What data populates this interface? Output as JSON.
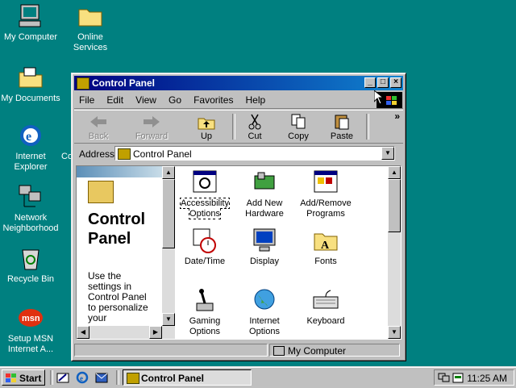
{
  "desktop": {
    "icons": [
      {
        "label": "My Computer"
      },
      {
        "label": "Online Services"
      },
      {
        "label": "My Documents"
      },
      {
        "label": "Internet Explorer"
      },
      {
        "label": "Network Neighborhood"
      },
      {
        "label": "Recycle Bin"
      },
      {
        "label": "Setup MSN Internet A..."
      }
    ],
    "partial_label": "Co"
  },
  "window": {
    "title": "Control Panel",
    "menu": [
      "File",
      "Edit",
      "View",
      "Go",
      "Favorites",
      "Help"
    ],
    "toolbar": {
      "back": "Back",
      "forward": "Forward",
      "up": "Up",
      "cut": "Cut",
      "copy": "Copy",
      "paste": "Paste",
      "more": "»"
    },
    "address": {
      "label": "Address",
      "value": "Control Panel"
    },
    "left_pane": {
      "title": "Control Panel",
      "description": "Use the settings in Control Panel to personalize your"
    },
    "items": [
      {
        "label": "Accessibility Options",
        "icon": "accessibility-icon"
      },
      {
        "label": "Add New Hardware",
        "icon": "hardware-icon"
      },
      {
        "label": "Add/Remove Programs",
        "icon": "programs-icon"
      },
      {
        "label": "Date/Time",
        "icon": "clock-icon"
      },
      {
        "label": "Display",
        "icon": "display-icon"
      },
      {
        "label": "Fonts",
        "icon": "fonts-icon"
      },
      {
        "label": "Gaming Options",
        "icon": "joystick-icon"
      },
      {
        "label": "Internet Options",
        "icon": "globe-icon"
      },
      {
        "label": "Keyboard",
        "icon": "keyboard-icon"
      }
    ],
    "status": {
      "location": "My Computer"
    }
  },
  "taskbar": {
    "start": "Start",
    "task": "Control Panel",
    "clock": "11:25 AM"
  },
  "colors": {
    "desktop": "#008080",
    "titlebar": "#000080",
    "face": "#c0c0c0"
  }
}
